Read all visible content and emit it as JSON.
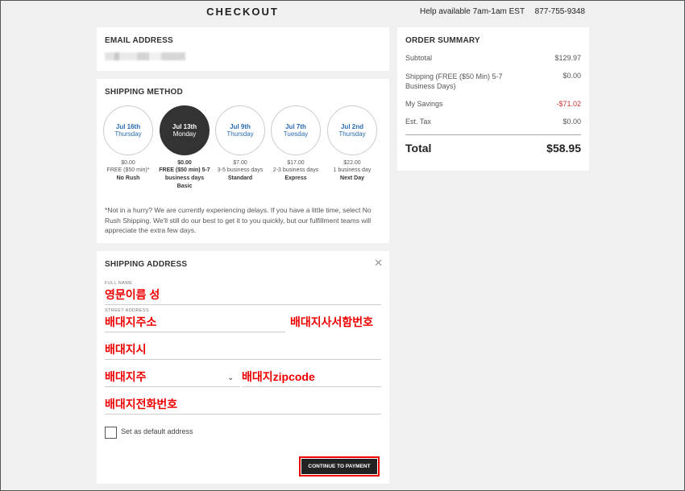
{
  "header": {
    "title": "CHECKOUT",
    "help": "Help available 7am-1am EST",
    "phone": "877-755-9348"
  },
  "email": {
    "title": "EMAIL ADDRESS"
  },
  "shipping_method": {
    "title": "SHIPPING METHOD",
    "options": [
      {
        "date": "Jul 16th",
        "day": "Thursday",
        "price": "$0.00",
        "desc": "FREE ($50 min)*",
        "name": "No Rush",
        "selected": false
      },
      {
        "date": "Jul 13th",
        "day": "Monday",
        "price": "$0.00",
        "desc": "FREE ($50 min) 5-7 business days",
        "name": "Basic",
        "selected": true
      },
      {
        "date": "Jul 9th",
        "day": "Thursday",
        "price": "$7.00",
        "desc": "3-5 business days",
        "name": "Standard",
        "selected": false
      },
      {
        "date": "Jul 7th",
        "day": "Tuesday",
        "price": "$17.00",
        "desc": "2-3 business days",
        "name": "Express",
        "selected": false
      },
      {
        "date": "Jul 2nd",
        "day": "Thursday",
        "price": "$22.00",
        "desc": "1 business day",
        "name": "Next Day",
        "selected": false
      }
    ],
    "note": "*Not in a hurry? We are currently experiencing delays. If you have a little time, select No Rush Shipping. We'll still do our best to get it to you quickly, but our fulfillment teams will appreciate the extra few days."
  },
  "shipping_address": {
    "title": "SHIPPING ADDRESS",
    "full_name_label": "FULL NAME",
    "full_name_value": "영문이름 성",
    "street_label": "STREET ADDRESS",
    "street_value": "배대지주소",
    "suite_value": "배대지사서함번호",
    "city_value": "배대지시",
    "state_value": "배대지주",
    "zip_value": "배대지zipcode",
    "phone_value": "배대지전화번호",
    "default_label": "Set as default address",
    "continue_label": "CONTINUE TO PAYMENT"
  },
  "order_summary": {
    "title": "ORDER SUMMARY",
    "subtotal_label": "Subtotal",
    "subtotal_value": "$129.97",
    "shipping_label": "Shipping (FREE ($50 Min) 5-7 Business Days)",
    "shipping_value": "$0.00",
    "savings_label": "My Savings",
    "savings_value": "-$71.02",
    "tax_label": "Est. Tax",
    "tax_value": "$0.00",
    "total_label": "Total",
    "total_value": "$58.95"
  }
}
